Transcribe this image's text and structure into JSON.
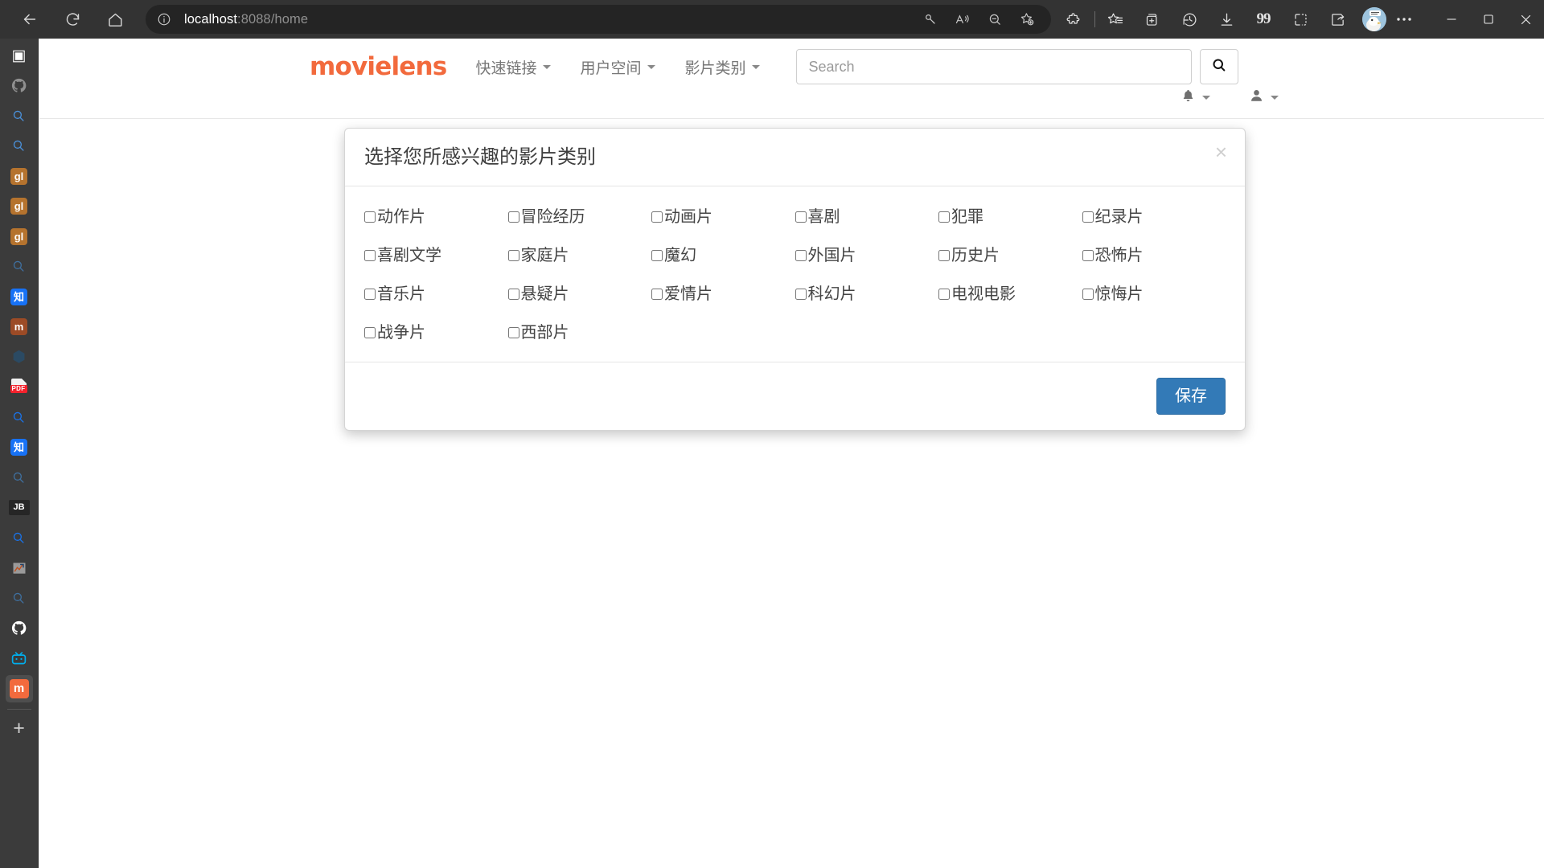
{
  "browser": {
    "nav": {
      "back_label": "Back",
      "reload_label": "Refresh",
      "home_label": "Home"
    },
    "address": {
      "host": "localhost",
      "path": ":8088/home",
      "full_url": "localhost:8088/home",
      "site_info_icon": "info-circle-icon",
      "actions": [
        "key-icon",
        "read-aloud-icon",
        "zoom-out-icon",
        "add-favorite-icon"
      ]
    },
    "toolbar": [
      {
        "icon": "extensions-puzzle-icon",
        "label": "Extensions"
      },
      {
        "icon": "favorites-list-icon",
        "label": "Favorites"
      },
      {
        "icon": "collections-add-icon",
        "label": "Collections"
      },
      {
        "icon": "history-clock-icon",
        "label": "History"
      },
      {
        "icon": "downloads-arrow-icon",
        "label": "Downloads"
      },
      {
        "icon": "quotes-icon",
        "label": "99"
      },
      {
        "icon": "split-screen-icon",
        "label": "Split screen"
      },
      {
        "icon": "share-icon",
        "label": "Share"
      }
    ],
    "quotes_glyph": "99",
    "profile": {
      "icon": "avatar-bird",
      "label": "Profile"
    },
    "more_label": "Settings and more",
    "window_controls": {
      "minimize": "—",
      "maximize": "❐",
      "close": "✕"
    }
  },
  "sidebar": {
    "items": [
      {
        "name": "app-panel",
        "kind": "glyph",
        "glyph": "▣",
        "color": "#ffffff",
        "active": false
      },
      {
        "name": "github",
        "kind": "github",
        "color": "#8f8f8f",
        "active": false
      },
      {
        "name": "search-1",
        "kind": "search",
        "color": "#4a90d9",
        "active": false
      },
      {
        "name": "search-2",
        "kind": "search",
        "color": "#4a90d9",
        "active": false
      },
      {
        "name": "gitlab-1",
        "kind": "badge",
        "text": "gl",
        "bg": "#b5732e",
        "active": false
      },
      {
        "name": "gitlab-2",
        "kind": "badge",
        "text": "gl",
        "bg": "#b5732e",
        "active": false
      },
      {
        "name": "gitlab-3",
        "kind": "badge",
        "text": "gl",
        "bg": "#b5732e",
        "active": false
      },
      {
        "name": "search-3",
        "kind": "search",
        "color": "#3f6f9e",
        "active": false
      },
      {
        "name": "zhihu-1",
        "kind": "badge",
        "text": "知",
        "bg": "#1772f6",
        "active": false
      },
      {
        "name": "maoyan",
        "kind": "badge",
        "text": "m",
        "bg": "#9c4b26",
        "active": false
      },
      {
        "name": "juejin",
        "kind": "glyph",
        "glyph": "⬢",
        "color": "#2b4a63",
        "active": false
      },
      {
        "name": "pdf",
        "kind": "pdf",
        "text": "PDF",
        "bg": "#f5222d",
        "active": false
      },
      {
        "name": "search-4",
        "kind": "search",
        "color": "#1a73e8",
        "active": false
      },
      {
        "name": "zhihu-2",
        "kind": "badge",
        "text": "知",
        "bg": "#1772f6",
        "active": false
      },
      {
        "name": "search-5",
        "kind": "search",
        "color": "#3f6f9e",
        "active": false
      },
      {
        "name": "jetbrains",
        "kind": "badge-wide",
        "text": "JB",
        "bg": "#262626",
        "active": false
      },
      {
        "name": "search-6",
        "kind": "search",
        "color": "#1a73e8",
        "active": false
      },
      {
        "name": "stocks-chart",
        "kind": "chart",
        "bg": "#9a9a9a",
        "active": false
      },
      {
        "name": "search-7",
        "kind": "search",
        "color": "#3f6f9e",
        "active": false
      },
      {
        "name": "github-2",
        "kind": "github",
        "color": "#ffffff",
        "active": false
      },
      {
        "name": "bilibili",
        "kind": "bilibili",
        "color": "#00aeec",
        "active": false
      },
      {
        "name": "movielens-app",
        "kind": "badge",
        "text": "m",
        "bg": "#f26a3d",
        "active": true
      }
    ],
    "add_label": "+"
  },
  "site": {
    "brand": "movielens",
    "nav_links": [
      {
        "label": "快速链接",
        "has_caret": true
      },
      {
        "label": "用户空间",
        "has_caret": true
      },
      {
        "label": "影片类别",
        "has_caret": true
      }
    ],
    "search": {
      "placeholder": "Search",
      "value": "",
      "button_icon": "search-icon"
    },
    "account": {
      "notifications_icon": "bell-icon",
      "user_icon": "user-icon"
    }
  },
  "modal": {
    "title": "选择您所感兴趣的影片类别",
    "close_glyph": "×",
    "save_label": "保存",
    "save_color": "#337ab7",
    "genres": [
      {
        "label": "动作片",
        "checked": false
      },
      {
        "label": "冒险经历",
        "checked": false
      },
      {
        "label": "动画片",
        "checked": false
      },
      {
        "label": "喜剧",
        "checked": false
      },
      {
        "label": "犯罪",
        "checked": false
      },
      {
        "label": "纪录片",
        "checked": false
      },
      {
        "label": "喜剧文学",
        "checked": false
      },
      {
        "label": "家庭片",
        "checked": false
      },
      {
        "label": "魔幻",
        "checked": false
      },
      {
        "label": "外国片",
        "checked": false
      },
      {
        "label": "历史片",
        "checked": false
      },
      {
        "label": "恐怖片",
        "checked": false
      },
      {
        "label": "音乐片",
        "checked": false
      },
      {
        "label": "悬疑片",
        "checked": false
      },
      {
        "label": "爱情片",
        "checked": false
      },
      {
        "label": "科幻片",
        "checked": false
      },
      {
        "label": "电视电影",
        "checked": false
      },
      {
        "label": "惊悔片",
        "checked": false
      },
      {
        "label": "战争片",
        "checked": false
      },
      {
        "label": "西部片",
        "checked": false
      }
    ]
  }
}
